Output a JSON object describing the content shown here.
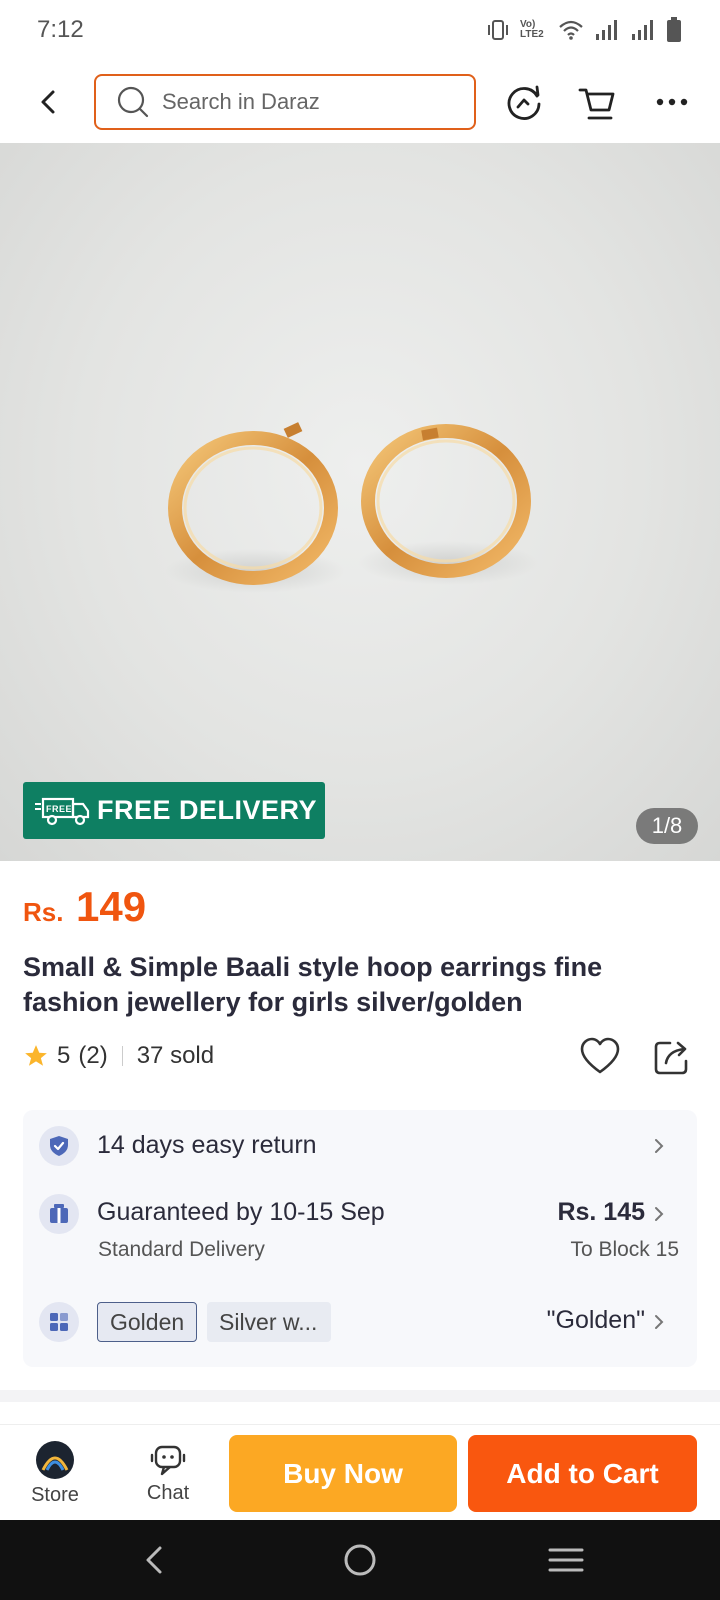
{
  "status_bar": {
    "time": "7:12",
    "network_label": "Vo) LTE2"
  },
  "header": {
    "search_placeholder": "Search in Daraz",
    "icons": [
      "back-icon",
      "search-icon",
      "history-icon",
      "cart-icon",
      "more-icon"
    ]
  },
  "gallery": {
    "badge_text": "FREE DELIVERY",
    "badge_truck_text": "FREE",
    "counter": "1/8",
    "accent": "#0e7f62"
  },
  "product": {
    "currency": "Rs.",
    "price": "149",
    "title": "Small & Simple Baali style hoop earrings fine fashion jewellery for girls silver/golden",
    "rating": "5",
    "rating_count": "(2)",
    "sold": "37 sold"
  },
  "info": {
    "return_text": "14 days easy return",
    "delivery_title": "Guaranteed by 10-15 Sep",
    "delivery_type": "Standard Delivery",
    "delivery_fee": "Rs. 145",
    "delivery_location": "To Block 15",
    "variants": [
      "Golden",
      "Silver w..."
    ],
    "selected_variant": "\"Golden\""
  },
  "bottom_bar": {
    "store_label": "Store",
    "chat_label": "Chat",
    "buy_now_label": "Buy Now",
    "add_to_cart_label": "Add to Cart"
  },
  "colors": {
    "brand_orange": "#f9570f",
    "buy_now": "#fca823",
    "price": "#f0550f",
    "free_delivery": "#0e7f62"
  }
}
